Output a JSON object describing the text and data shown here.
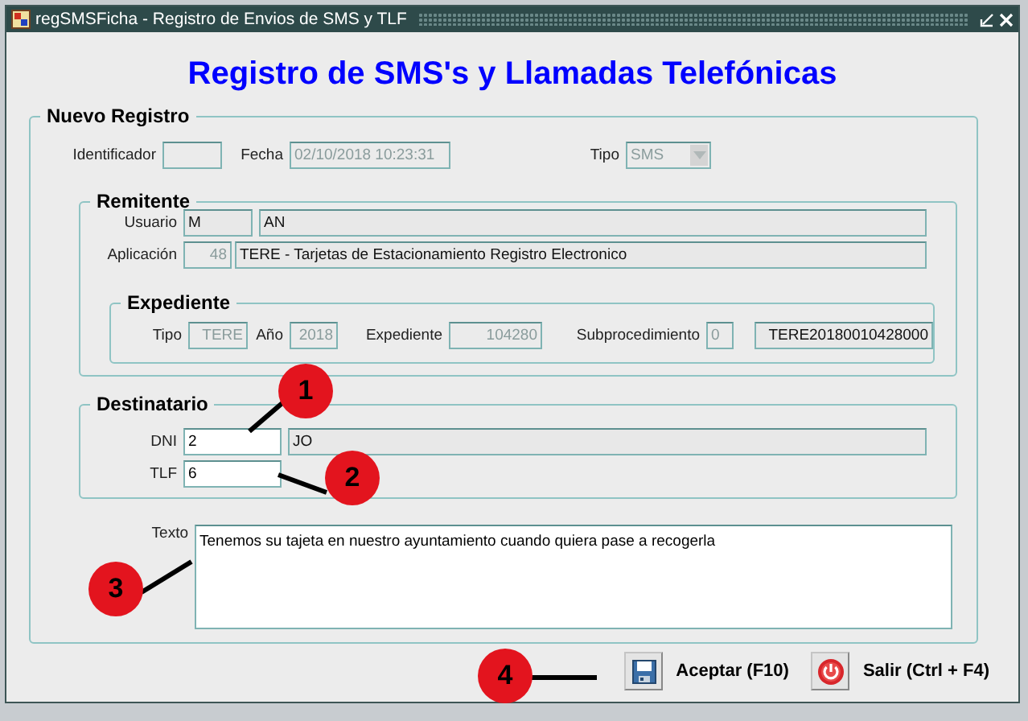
{
  "window": {
    "title": "regSMSFicha - Registro de Envios de SMS y TLF"
  },
  "heading": "Registro de SMS's y Llamadas Telefónicas",
  "nuevo_registro": {
    "legend": "Nuevo Registro",
    "fields": [
      {
        "label": "Identificador",
        "kind": "disabled"
      },
      {
        "label": "Fecha",
        "value": "02/10/2018 10:23:31",
        "kind": "disabled"
      },
      {
        "label": "Tipo",
        "value": "SMS",
        "kind": "select"
      }
    ]
  },
  "remitente": {
    "legend": "Remitente",
    "rows": [
      [
        {
          "label": "Usuario",
          "value": "M",
          "kind": "readonly"
        },
        {
          "value": "AN",
          "kind": "readonly"
        }
      ],
      [
        {
          "label": "Aplicación",
          "value": "48",
          "kind": "disabled"
        },
        {
          "value": "TERE - Tarjetas de Estacionamiento Registro Electronico",
          "kind": "readonly"
        }
      ]
    ]
  },
  "expediente": {
    "legend": "Expediente",
    "fields": [
      {
        "label": "Tipo",
        "value": "TERE",
        "kind": "disabled"
      },
      {
        "label": "Año",
        "value": "2018",
        "kind": "disabled"
      },
      {
        "label": "Expediente",
        "value": "104280",
        "kind": "disabled"
      },
      {
        "label": "Subprocedimiento",
        "value": "0",
        "kind": "disabled"
      },
      {
        "value": "TERE20180010428000",
        "kind": "readonly"
      }
    ]
  },
  "destinatario": {
    "legend": "Destinatario",
    "rows": [
      [
        {
          "label": "DNI",
          "value": "2",
          "kind": "input"
        },
        {
          "value": "JO",
          "kind": "readonly"
        }
      ],
      [
        {
          "label": "TLF",
          "value": "6",
          "kind": "input"
        }
      ]
    ]
  },
  "texto": {
    "label": "Texto",
    "value": "Tenemos su tajeta en nuestro ayuntamiento cuando quiera pase a recogerla",
    "kind": "input"
  },
  "buttons": [
    {
      "label": "Aceptar (F10)",
      "kind": "save"
    },
    {
      "label": "Salir (Ctrl + F4)",
      "kind": "exit"
    }
  ],
  "callouts": [
    {
      "number": "1"
    },
    {
      "number": "2"
    },
    {
      "number": "3"
    },
    {
      "number": "4"
    }
  ]
}
